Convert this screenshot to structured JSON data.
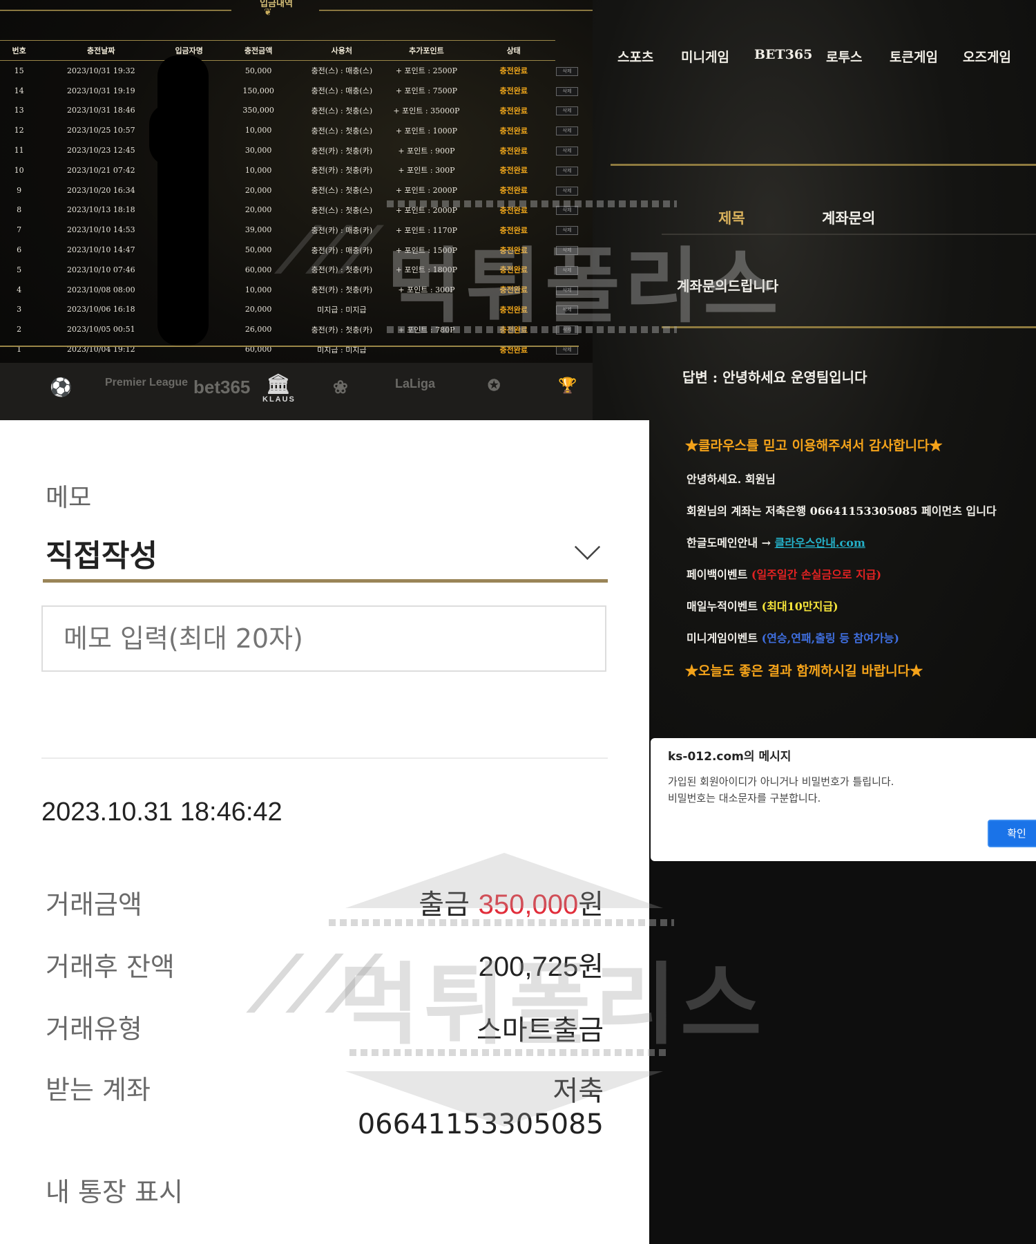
{
  "deposit": {
    "title": "입금내역",
    "columns": [
      "번호",
      "충전날짜",
      "입금자명",
      "충전금액",
      "사용처",
      "추가포인트",
      "상태"
    ],
    "rows": [
      {
        "no": "15",
        "date": "2023/10/31 19:32",
        "amount": "50,000",
        "usage": "충전(스) : 매충(스)",
        "point": "+ 포인트 : 2500P",
        "status": "충전완료"
      },
      {
        "no": "14",
        "date": "2023/10/31 19:19",
        "amount": "150,000",
        "usage": "충전(스) : 매충(스)",
        "point": "+ 포인트 : 7500P",
        "status": "충전완료"
      },
      {
        "no": "13",
        "date": "2023/10/31 18:46",
        "amount": "350,000",
        "usage": "충전(스) : 첫충(스)",
        "point": "+ 포인트 : 35000P",
        "status": "충전완료"
      },
      {
        "no": "12",
        "date": "2023/10/25 10:57",
        "amount": "10,000",
        "usage": "충전(스) : 첫충(스)",
        "point": "+ 포인트 : 1000P",
        "status": "충전완료"
      },
      {
        "no": "11",
        "date": "2023/10/23 12:45",
        "amount": "30,000",
        "usage": "충전(카) : 첫충(카)",
        "point": "+ 포인트 : 900P",
        "status": "충전완료"
      },
      {
        "no": "10",
        "date": "2023/10/21 07:42",
        "amount": "10,000",
        "usage": "충전(카) : 첫충(카)",
        "point": "+ 포인트 : 300P",
        "status": "충전완료"
      },
      {
        "no": "9",
        "date": "2023/10/20 16:34",
        "amount": "20,000",
        "usage": "충전(스) : 첫충(스)",
        "point": "+ 포인트 : 2000P",
        "status": "충전완료"
      },
      {
        "no": "8",
        "date": "2023/10/13 18:18",
        "amount": "20,000",
        "usage": "충전(스) : 첫충(스)",
        "point": "+ 포인트 : 2000P",
        "status": "충전완료"
      },
      {
        "no": "7",
        "date": "2023/10/10 14:53",
        "amount": "39,000",
        "usage": "충전(카) : 매충(카)",
        "point": "+ 포인트 : 1170P",
        "status": "충전완료"
      },
      {
        "no": "6",
        "date": "2023/10/10 14:47",
        "amount": "50,000",
        "usage": "충전(카) : 매충(카)",
        "point": "+ 포인트 : 1500P",
        "status": "충전완료"
      },
      {
        "no": "5",
        "date": "2023/10/10 07:46",
        "amount": "60,000",
        "usage": "충전(카) : 첫충(카)",
        "point": "+ 포인트 : 1800P",
        "status": "충전완료"
      },
      {
        "no": "4",
        "date": "2023/10/08 08:00",
        "amount": "10,000",
        "usage": "충전(카) : 첫충(카)",
        "point": "+ 포인트 : 300P",
        "status": "충전완료"
      },
      {
        "no": "3",
        "date": "2023/10/06 16:18",
        "amount": "20,000",
        "usage": "미지급 : 미지급",
        "point": "",
        "status": "충전완료"
      },
      {
        "no": "2",
        "date": "2023/10/05 00:51",
        "amount": "26,000",
        "usage": "충전(카) : 첫충(카)",
        "point": "+ 포인트 : 780P",
        "status": "충전완료"
      },
      {
        "no": "1",
        "date": "2023/10/04 19:12",
        "amount": "60,000",
        "usage": "미지급 : 미지급",
        "point": "",
        "status": "충전완료"
      }
    ],
    "delete_label": "삭제",
    "logos": [
      "Premier League",
      "bet365",
      "KLAUS",
      "LaLiga"
    ]
  },
  "qna": {
    "nav": [
      "스포츠",
      "미니게임",
      "BET365",
      "로투스",
      "토큰게임",
      "오즈게임"
    ],
    "subject_label": "제목",
    "subject_value": "계좌문의",
    "question": "계좌문의드립니다",
    "answer": "답변 : 안녕하세요 운영팀입니다",
    "thanks": "★클라우스를 믿고 이용해주셔서 감사합니다★",
    "greeting": "안녕하세요. 회원님",
    "account_line": "회원님의 계좌는 저축은행 06641153305085 페이먼츠 입니다",
    "domain_prefix": "한글도메인안내 → ",
    "domain_link": "클라우스안내.com",
    "payback_prefix": "페이백이벤트 ",
    "payback_detail": "(일주일간 손실금으로 지급)",
    "daily_prefix": "매일누적이벤트 ",
    "daily_detail": "(최대10만지급)",
    "mini_prefix": "미니게임이벤트 ",
    "mini_detail": "(연승,연패,출링 등 참여가능)",
    "closing": "★오늘도 좋은 결과 함께하시길 바랍니다★"
  },
  "dialog": {
    "title": "ks-012.com의 메시지",
    "line1": "가입된 회원아이디가 아니거나 비밀번호가 틀립니다.",
    "line2": "비밀번호는 대소문자를 구분합니다.",
    "ok": "확인"
  },
  "transaction": {
    "memo_label": "메모",
    "memo_value": "직접작성",
    "memo_placeholder": "메모 입력(최대 20자)",
    "datetime": "2023.10.31 18:46:42",
    "amount_label": "거래금액",
    "amount_prefix": "출금 ",
    "amount_value": "350,000",
    "amount_unit": "원",
    "balance_label": "거래후 잔액",
    "balance_value": "200,725",
    "balance_unit": "원",
    "type_label": "거래유형",
    "type_value": "스마트출금",
    "account_label": "받는 계좌",
    "account_bank": "저축",
    "account_number": "06641153305085",
    "passbook_label": "내 통장 표시"
  },
  "watermark": "먹튀폴리스",
  "colors": {
    "gold": "#9b8748",
    "status_orange": "#f2a81b",
    "amount_red": "#e12d3a",
    "link_cyan": "#24b0c8"
  }
}
